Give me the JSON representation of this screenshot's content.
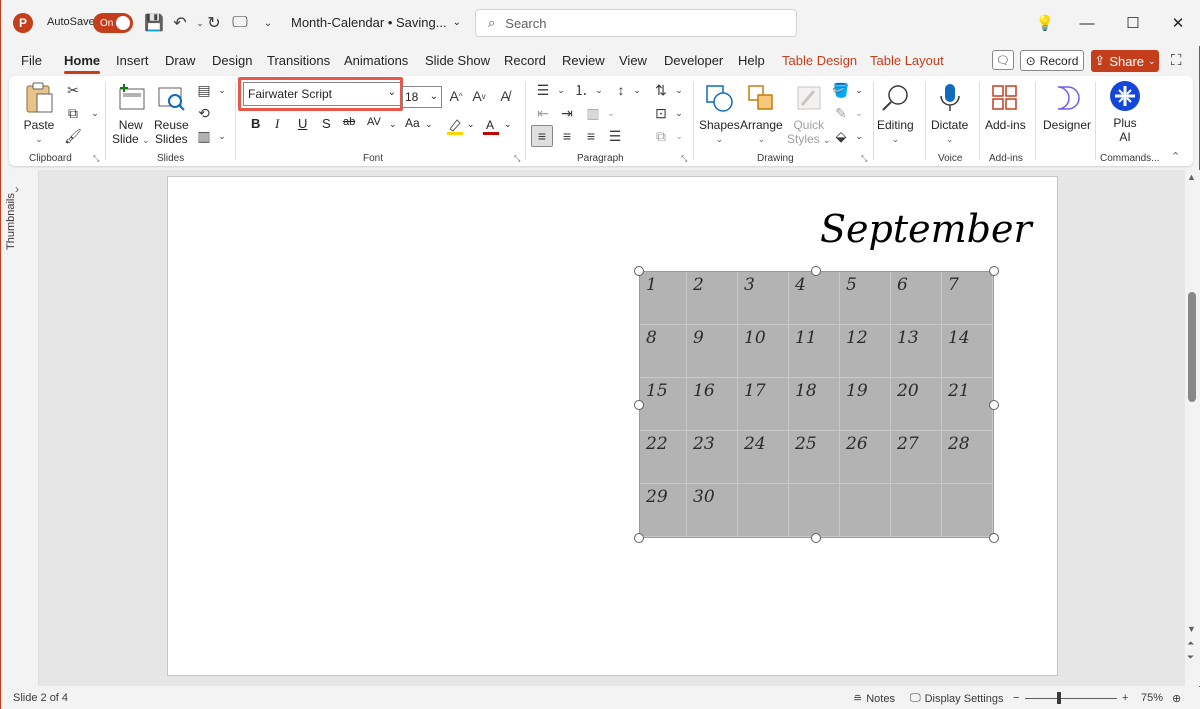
{
  "titlebar": {
    "app_icon": "P",
    "autosave_label": "AutoSave",
    "autosave_state": "On",
    "doc_title": "Month-Calendar • Saving...",
    "search_placeholder": "Search"
  },
  "tabs": [
    "File",
    "Home",
    "Insert",
    "Draw",
    "Design",
    "Transitions",
    "Animations",
    "Slide Show",
    "Record",
    "Review",
    "View",
    "Developer",
    "Help",
    "Table Design",
    "Table Layout"
  ],
  "tab_actions": {
    "record": "Record",
    "share": "Share"
  },
  "ribbon": {
    "clipboard": {
      "paste": "Paste",
      "label": "Clipboard"
    },
    "slides": {
      "new_slide_1": "New",
      "new_slide_2": "Slide",
      "reuse_1": "Reuse",
      "reuse_2": "Slides",
      "label": "Slides"
    },
    "font": {
      "name": "Fairwater Script",
      "size": "18",
      "label": "Font",
      "bold": "B",
      "italic": "I",
      "underline": "U",
      "shadow": "S",
      "strike": "ab",
      "spacing": "AV",
      "case": "Aa"
    },
    "paragraph": {
      "label": "Paragraph"
    },
    "drawing": {
      "shapes": "Shapes",
      "arrange": "Arrange",
      "quick_1": "Quick",
      "quick_2": "Styles",
      "label": "Drawing"
    },
    "editing": {
      "label": "Editing"
    },
    "voice": {
      "dictate": "Dictate",
      "label": "Voice"
    },
    "addins": {
      "addins": "Add-ins",
      "label": "Add-ins"
    },
    "designer": {
      "label": "Designer"
    },
    "plusai": {
      "line1": "Plus",
      "line2": "AI",
      "label": "Commands..."
    }
  },
  "left_pane": {
    "label": "Thumbnails"
  },
  "slide": {
    "month": "September",
    "days": [
      "1",
      "2",
      "3",
      "4",
      "5",
      "6",
      "7",
      "8",
      "9",
      "10",
      "11",
      "12",
      "13",
      "14",
      "15",
      "16",
      "17",
      "18",
      "19",
      "20",
      "21",
      "22",
      "23",
      "24",
      "25",
      "26",
      "27",
      "28",
      "29",
      "30",
      "",
      "",
      "",
      "",
      ""
    ]
  },
  "status": {
    "slide_info": "Slide 2 of 4",
    "notes": "Notes",
    "display_settings": "Display Settings",
    "zoom": "75%"
  },
  "colors": {
    "accent": "#c43e1c",
    "highlight_box": "#e8584a",
    "table_fill": "#b3b3b3"
  }
}
